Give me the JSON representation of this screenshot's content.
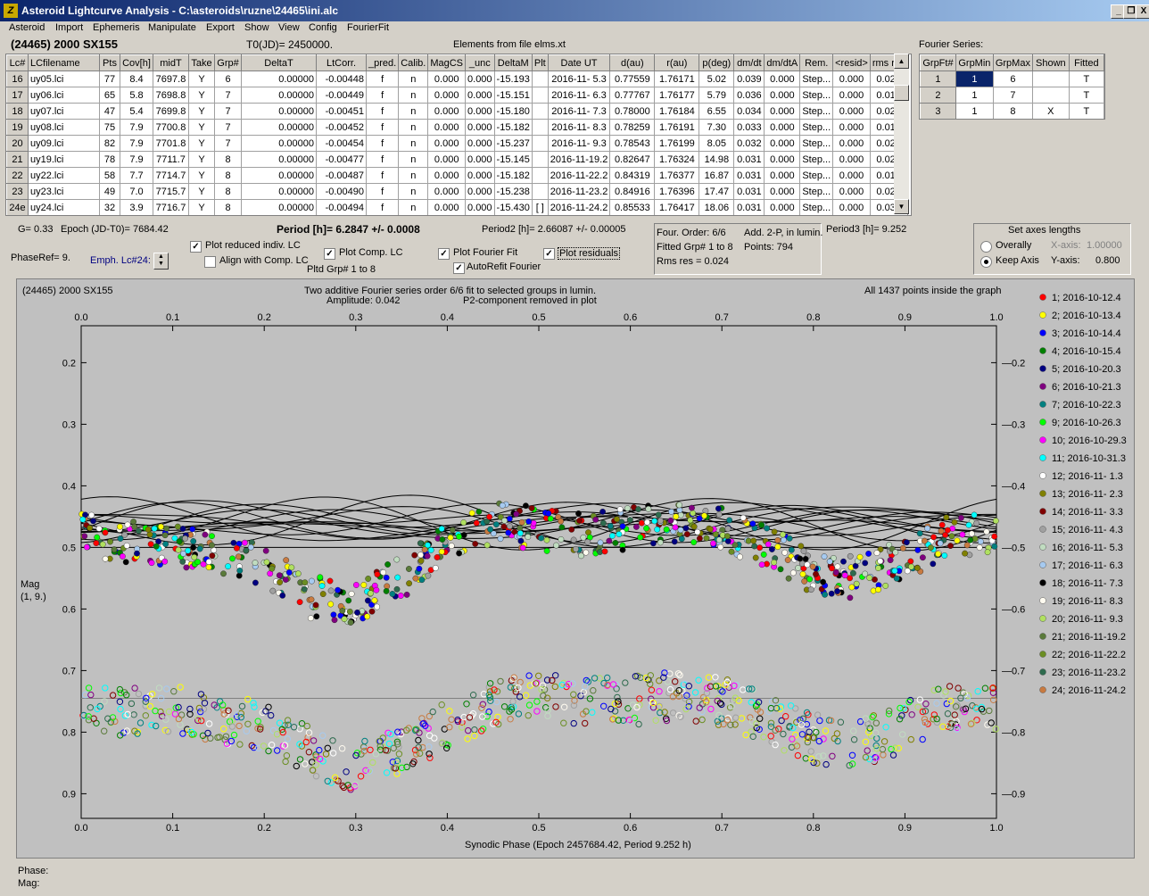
{
  "window": {
    "title": "Asteroid Lightcurve Analysis - C:\\asteroids\\ruzne\\24465\\ini.alc",
    "app_icon": "Z",
    "min_label": "_",
    "restore_label": "❐",
    "close_label": "X"
  },
  "menu": {
    "items": [
      "Asteroid",
      "Import",
      "Ephemeris",
      "Manipulate",
      "Export",
      "Show",
      "View",
      "Config",
      "FourierFit"
    ]
  },
  "header": {
    "asteroid": "(24465) 2000 SX155",
    "t0": "T0(JD)= 2450000.",
    "elements": "Elements from file elms.xt",
    "fourier_series_label": "Fourier Series:"
  },
  "lc_table": {
    "columns": [
      "Lc#",
      "LCfilename",
      "Pts",
      "Cov[h]",
      "midT",
      "Take",
      "Grp#",
      "DeltaT",
      "LtCorr.",
      "_pred.",
      "Calib.",
      "MagCS",
      "_unc",
      "DeltaM",
      "Plt",
      "Date UT",
      "d(au)",
      "r(au)",
      "p(deg)",
      "dm/dt",
      "dm/dtA",
      "Rem.",
      "<resid>",
      "rms res"
    ],
    "rows": [
      [
        "16",
        "uy05.lci",
        "77",
        "8.4",
        "7697.8",
        "Y",
        "6",
        "0.00000",
        "-0.00448",
        "f",
        "n",
        "0.000",
        "0.000",
        "-15.193",
        "",
        "2016-11- 5.3",
        "0.77559",
        "1.76171",
        "5.02",
        "0.039",
        "0.000",
        "Step...",
        "0.000",
        "0.027"
      ],
      [
        "17",
        "uy06.lci",
        "65",
        "5.8",
        "7698.8",
        "Y",
        "7",
        "0.00000",
        "-0.00449",
        "f",
        "n",
        "0.000",
        "0.000",
        "-15.151",
        "",
        "2016-11- 6.3",
        "0.77767",
        "1.76177",
        "5.79",
        "0.036",
        "0.000",
        "Step...",
        "0.000",
        "0.016"
      ],
      [
        "18",
        "uy07.lci",
        "47",
        "5.4",
        "7699.8",
        "Y",
        "7",
        "0.00000",
        "-0.00451",
        "f",
        "n",
        "0.000",
        "0.000",
        "-15.180",
        "",
        "2016-11- 7.3",
        "0.78000",
        "1.76184",
        "6.55",
        "0.034",
        "0.000",
        "Step...",
        "0.000",
        "0.022"
      ],
      [
        "19",
        "uy08.lci",
        "75",
        "7.9",
        "7700.8",
        "Y",
        "7",
        "0.00000",
        "-0.00452",
        "f",
        "n",
        "0.000",
        "0.000",
        "-15.182",
        "",
        "2016-11- 8.3",
        "0.78259",
        "1.76191",
        "7.30",
        "0.033",
        "0.000",
        "Step...",
        "0.000",
        "0.014"
      ],
      [
        "20",
        "uy09.lci",
        "82",
        "7.9",
        "7701.8",
        "Y",
        "7",
        "0.00000",
        "-0.00454",
        "f",
        "n",
        "0.000",
        "0.000",
        "-15.237",
        "",
        "2016-11- 9.3",
        "0.78543",
        "1.76199",
        "8.05",
        "0.032",
        "0.000",
        "Step...",
        "0.000",
        "0.029"
      ],
      [
        "21",
        "uy19.lci",
        "78",
        "7.9",
        "7711.7",
        "Y",
        "8",
        "0.00000",
        "-0.00477",
        "f",
        "n",
        "0.000",
        "0.000",
        "-15.145",
        "",
        "2016-11-19.2",
        "0.82647",
        "1.76324",
        "14.98",
        "0.031",
        "0.000",
        "Step...",
        "0.000",
        "0.026"
      ],
      [
        "22",
        "uy22.lci",
        "58",
        "7.7",
        "7714.7",
        "Y",
        "8",
        "0.00000",
        "-0.00487",
        "f",
        "n",
        "0.000",
        "0.000",
        "-15.182",
        "",
        "2016-11-22.2",
        "0.84319",
        "1.76377",
        "16.87",
        "0.031",
        "0.000",
        "Step...",
        "0.000",
        "0.015"
      ],
      [
        "23",
        "uy23.lci",
        "49",
        "7.0",
        "7715.7",
        "Y",
        "8",
        "0.00000",
        "-0.00490",
        "f",
        "n",
        "0.000",
        "0.000",
        "-15.238",
        "",
        "2016-11-23.2",
        "0.84916",
        "1.76396",
        "17.47",
        "0.031",
        "0.000",
        "Step...",
        "0.000",
        "0.020"
      ],
      [
        "24e",
        "uy24.lci",
        "32",
        "3.9",
        "7716.7",
        "Y",
        "8",
        "0.00000",
        "-0.00494",
        "f",
        "n",
        "0.000",
        "0.000",
        "-15.430",
        "[ ]",
        "2016-11-24.2",
        "0.85533",
        "1.76417",
        "18.06",
        "0.031",
        "0.000",
        "Step...",
        "0.000",
        "0.032"
      ]
    ]
  },
  "fourier_table": {
    "columns": [
      "GrpFt#",
      "GrpMin",
      "GrpMax",
      "Shown",
      "Fitted"
    ],
    "rows": [
      [
        "1",
        "1",
        "6",
        "",
        "T"
      ],
      [
        "2",
        "1",
        "7",
        "",
        "T"
      ],
      [
        "3",
        "1",
        "8",
        "X",
        "T"
      ]
    ]
  },
  "controls": {
    "g": "G= 0.33",
    "epoch": "Epoch (JD-T0)= 7684.42",
    "phase_ref": "PhaseRef= 9.",
    "emph": "Emph. Lc#24:",
    "period": "Period [h]= 6.2847 +/- 0.0008",
    "period2": "Period2 [h]= 2.66087 +/- 0.00005",
    "period3": "Period3 [h]= 9.252",
    "plot_reduced": "Plot reduced indiv. LC",
    "align": "Align with Comp. LC",
    "plot_comp": "Plot Comp. LC",
    "pltd_grp": "Pltd Grp#  1   to   8",
    "plot_fourier": "Plot Fourier Fit",
    "autorefit": "AutoRefit Fourier",
    "plot_residuals": "Plot residuals",
    "four_order": "Four. Order:  6/6",
    "add2p": "Add. 2-P, in lumin.",
    "fitted_grp": "Fitted Grp# 1 to 8",
    "points": "Points: 794",
    "rms": "Rms res      = 0.024",
    "axes_title": "Set axes lengths",
    "overally": "Overally",
    "keep_axis": "Keep Axis",
    "xaxis": "X-axis:",
    "xaxis_val": "1.00000",
    "yaxis": "Y-axis:",
    "yaxis_val": "0.800"
  },
  "plot": {
    "name": "(24465) 2000 SX155",
    "title1": "Two additive Fourier series order 6/6 fit to selected groups in lumin.",
    "title2a": "Amplitude: 0.042",
    "title2b": "P2-component removed in plot",
    "inside": "All 1437 points inside the graph",
    "ylabel1": "Mag",
    "ylabel2": "(1, 9.)",
    "xlabel": "Synodic Phase (Epoch 2457684.42, Period 9.252 h)"
  },
  "chart_data": {
    "type": "scatter",
    "x_range": [
      0,
      1.0
    ],
    "y_range": [
      0.14,
      0.94
    ],
    "y_inverted": true,
    "x_ticks": [
      0.0,
      0.1,
      0.2,
      0.3,
      0.4,
      0.5,
      0.6,
      0.7,
      0.8,
      0.9,
      1.0
    ],
    "y_ticks": [
      0.2,
      0.3,
      0.4,
      0.5,
      0.6,
      0.7,
      0.8,
      0.9
    ],
    "composite_phase": [
      0,
      0.05,
      0.1,
      0.15,
      0.2,
      0.25,
      0.3,
      0.35,
      0.4,
      0.45,
      0.5,
      0.55,
      0.6,
      0.65,
      0.7,
      0.75,
      0.8,
      0.85,
      0.9,
      0.95,
      1.0
    ],
    "composite_mag": [
      0.48,
      0.49,
      0.5,
      0.51,
      0.53,
      0.58,
      0.59,
      0.55,
      0.49,
      0.46,
      0.47,
      0.48,
      0.47,
      0.46,
      0.47,
      0.5,
      0.54,
      0.55,
      0.52,
      0.48,
      0.48
    ],
    "residual_phase": [
      0,
      0.05,
      0.1,
      0.15,
      0.2,
      0.25,
      0.3,
      0.35,
      0.4,
      0.45,
      0.5,
      0.55,
      0.6,
      0.65,
      0.7,
      0.75,
      0.8,
      0.85,
      0.9,
      0.95,
      1.0
    ],
    "residual_mag": [
      0.76,
      0.77,
      0.76,
      0.78,
      0.79,
      0.83,
      0.86,
      0.83,
      0.79,
      0.75,
      0.74,
      0.75,
      0.75,
      0.74,
      0.75,
      0.78,
      0.81,
      0.82,
      0.79,
      0.76,
      0.76
    ],
    "residual_line": 0.745,
    "fit_line": 0.5,
    "legend": [
      {
        "label": "1; 2016-10-12.4",
        "color": "#ff0000"
      },
      {
        "label": "2; 2016-10-13.4",
        "color": "#ffff00"
      },
      {
        "label": "3; 2016-10-14.4",
        "color": "#0000ff"
      },
      {
        "label": "4; 2016-10-15.4",
        "color": "#008000"
      },
      {
        "label": "5; 2016-10-20.3",
        "color": "#000080"
      },
      {
        "label": "6; 2016-10-21.3",
        "color": "#800080"
      },
      {
        "label": "7; 2016-10-22.3",
        "color": "#008080"
      },
      {
        "label": "9; 2016-10-26.3",
        "color": "#00ff00"
      },
      {
        "label": "10; 2016-10-29.3",
        "color": "#ff00ff"
      },
      {
        "label": "11; 2016-10-31.3",
        "color": "#00ffff"
      },
      {
        "label": "12; 2016-11- 1.3",
        "color": "#ffffff"
      },
      {
        "label": "13; 2016-11- 2.3",
        "color": "#808000"
      },
      {
        "label": "14; 2016-11- 3.3",
        "color": "#800000"
      },
      {
        "label": "15; 2016-11- 4.3",
        "color": "#a0a0a0"
      },
      {
        "label": "16; 2016-11- 5.3",
        "color": "#c0dcc0"
      },
      {
        "label": "17; 2016-11- 6.3",
        "color": "#a6caf0"
      },
      {
        "label": "18; 2016-11- 7.3",
        "color": "#000000"
      },
      {
        "label": "19; 2016-11- 8.3",
        "color": "#fffbf0"
      },
      {
        "label": "20; 2016-11- 9.3",
        "color": "#b0e060"
      },
      {
        "label": "21; 2016-11-19.2",
        "color": "#5a7a3a"
      },
      {
        "label": "22; 2016-11-22.2",
        "color": "#6b8e23"
      },
      {
        "label": "23; 2016-11-23.2",
        "color": "#2e6b4e"
      },
      {
        "label": "24; 2016-11-24.2",
        "color": "#c87a40"
      }
    ]
  },
  "status": {
    "phase": "Phase:",
    "mag": "Mag:"
  },
  "colors": {
    "title_start": "#0a246a",
    "title_end": "#a6caf0",
    "panel": "#c0c0c0",
    "face": "#d4d0c8"
  }
}
